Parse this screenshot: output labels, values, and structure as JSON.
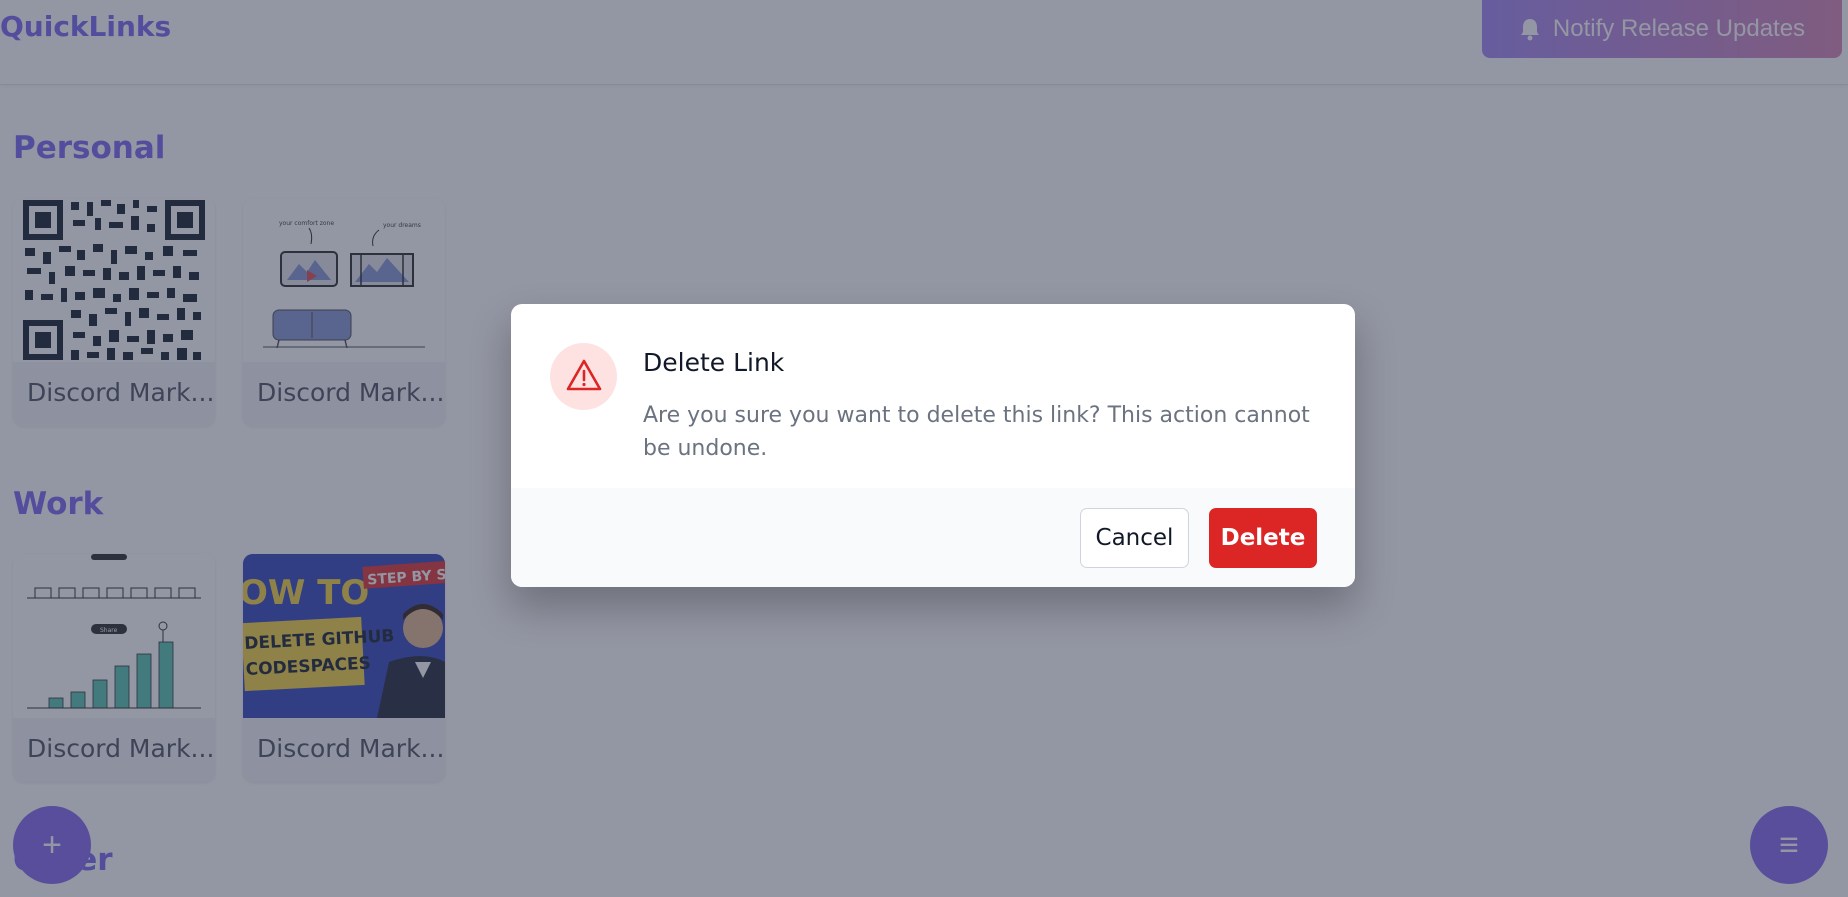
{
  "app": {
    "title": "QuickLinks",
    "notify_label": "Notify Release Updates"
  },
  "sections": [
    {
      "title": "Personal",
      "cards": [
        {
          "label": "Discord Mark...",
          "thumb": "qr-code-image"
        },
        {
          "label": "Discord Mark...",
          "thumb": "comfort-zone-illustration"
        }
      ]
    },
    {
      "title": "Work",
      "cards": [
        {
          "label": "Discord Mark...",
          "thumb": "growth-steps-illustration"
        },
        {
          "label": "Discord Mark...",
          "thumb": "github-codespaces-thumbnail"
        }
      ]
    },
    {
      "title": "Other",
      "cards": []
    }
  ],
  "thumb_texts": {
    "comfort_left": "your comfort zone",
    "comfort_right": "your dreams",
    "growth_tag": "Share",
    "yt_howto": "OW TO",
    "yt_step": "STEP BY STE",
    "yt_line1": "DELETE GITHUB",
    "yt_line2": "CODESPACES"
  },
  "fab": {
    "add_label": "+",
    "menu_label": "≡"
  },
  "modal": {
    "title": "Delete Link",
    "message": "Are you sure you want to delete this link? This action cannot be undone.",
    "cancel_label": "Cancel",
    "delete_label": "Delete"
  },
  "colors": {
    "brand": "#7c6cf0",
    "danger": "#dc2626",
    "danger_bg": "#fee2e2",
    "overlay": "rgba(40,46,72,0.5)"
  }
}
